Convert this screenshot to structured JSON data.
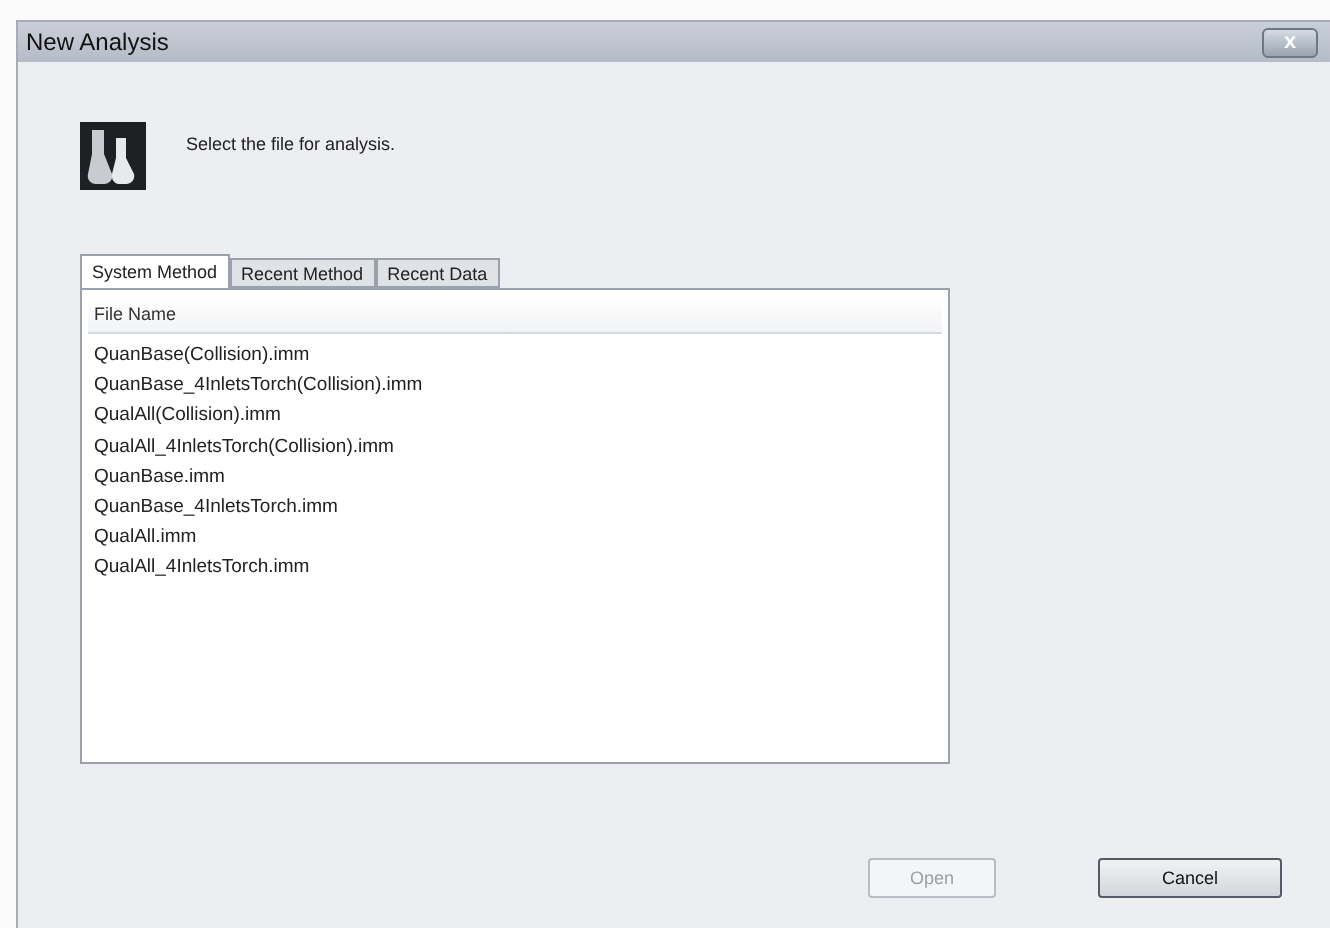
{
  "window": {
    "title": "New Analysis",
    "close": "x"
  },
  "prompt": "Select the file for analysis.",
  "tabs": [
    {
      "label": "System Method",
      "selected": true
    },
    {
      "label": "Recent Method",
      "selected": false
    },
    {
      "label": "Recent Data",
      "selected": false
    }
  ],
  "table": {
    "columns": [
      "File Name"
    ],
    "rows": [
      "QuanBase(Collision).imm",
      "QuanBase_4InletsTorch(Collision).imm",
      "QualAll(Collision).imm",
      "QualAll_4InletsTorch(Collision).imm",
      "QuanBase.imm",
      "QuanBase_4InletsTorch.imm",
      "QualAll.imm",
      "QualAll_4InletsTorch.imm"
    ]
  },
  "buttons": [
    {
      "label": "Open",
      "disabled": true
    },
    {
      "label": "Cancel",
      "disabled": false
    }
  ]
}
